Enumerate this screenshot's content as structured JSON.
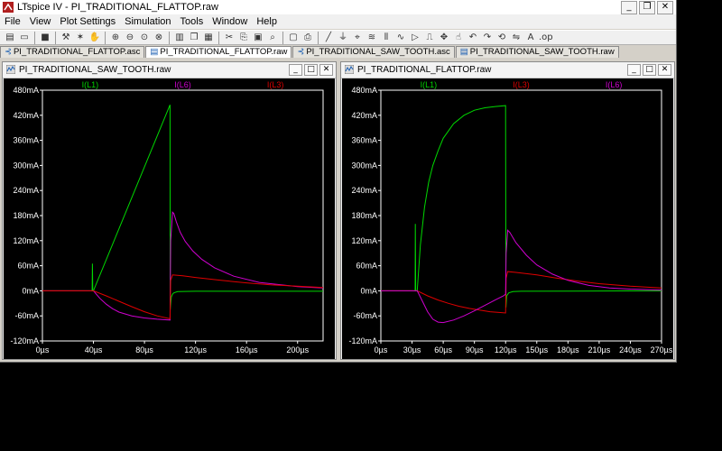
{
  "window": {
    "title": "LTspice IV - PI_TRADITIONAL_FLATTOP.raw",
    "buttons": {
      "minimize": "_",
      "restore": "❐",
      "close": "✕"
    }
  },
  "menu": [
    "File",
    "View",
    "Plot Settings",
    "Simulation",
    "Tools",
    "Window",
    "Help"
  ],
  "tabs": [
    {
      "label": "PI_TRADITIONAL_FLATTOP.asc",
      "icon": "schematic-icon",
      "active": false
    },
    {
      "label": "PI_TRADITIONAL_FLATTOP.raw",
      "icon": "waveform-icon",
      "active": true
    },
    {
      "label": "PI_TRADITIONAL_SAW_TOOTH.asc",
      "icon": "schematic-icon",
      "active": false
    },
    {
      "label": "PI_TRADITIONAL_SAW_TOOTH.raw",
      "icon": "waveform-icon",
      "active": false
    }
  ],
  "colors": {
    "green": "#00d800",
    "magenta": "#d000d0",
    "red": "#e00000",
    "plot_bg": "#000000",
    "axis": "#ffffff"
  },
  "panes": {
    "left": {
      "title": "PI_TRADITIONAL_SAW_TOOTH.raw",
      "btn_min": "_",
      "btn_max": "□",
      "btn_close": "✕"
    },
    "right": {
      "title": "PI_TRADITIONAL_FLATTOP.raw",
      "btn_min": "_",
      "btn_max": "□",
      "btn_close": "✕"
    }
  },
  "chart_data": [
    {
      "type": "line",
      "title": "",
      "xlabel": "",
      "ylabel": "",
      "xlim": [
        0,
        220
      ],
      "ylim": [
        -120,
        480
      ],
      "x_unit": "µs",
      "y_unit": "mA",
      "x_ticks": [
        0,
        40,
        80,
        120,
        160,
        200
      ],
      "x_tick_labels": [
        "0µs",
        "40µs",
        "80µs",
        "120µs",
        "160µs",
        "200µs"
      ],
      "y_ticks": [
        480,
        420,
        360,
        300,
        240,
        180,
        120,
        60,
        0,
        -60,
        -120
      ],
      "y_tick_labels": [
        "480mA",
        "420mA",
        "360mA",
        "300mA",
        "240mA",
        "180mA",
        "120mA",
        "60mA",
        "0mA",
        "-60mA",
        "-120mA"
      ],
      "legend": [
        "I(L1)",
        "I(L6)",
        "I(L3)"
      ],
      "series": [
        {
          "name": "I(L1)",
          "color": "green",
          "x": [
            0,
            39,
            39.2,
            39.5,
            40,
            100,
            100.2,
            101,
            102,
            103,
            106,
            120,
            220
          ],
          "y": [
            0,
            0,
            65,
            0,
            0,
            445,
            -45,
            -15,
            -8,
            -5,
            -2,
            -1,
            -1
          ]
        },
        {
          "name": "I(L6)",
          "color": "magenta",
          "x": [
            0,
            40,
            45,
            50,
            55,
            60,
            70,
            80,
            90,
            100,
            100.5,
            102,
            103,
            105,
            108,
            112,
            118,
            125,
            135,
            150,
            170,
            200,
            220
          ],
          "y": [
            0,
            0,
            -18,
            -32,
            -43,
            -51,
            -60,
            -65,
            -68,
            -70,
            120,
            188,
            185,
            165,
            140,
            118,
            95,
            75,
            55,
            35,
            20,
            10,
            7
          ]
        },
        {
          "name": "I(L3)",
          "color": "red",
          "x": [
            0,
            40,
            50,
            60,
            70,
            80,
            90,
            100,
            100.5,
            102,
            110,
            120,
            140,
            160,
            180,
            200,
            220
          ],
          "y": [
            0,
            0,
            -12,
            -25,
            -38,
            -50,
            -60,
            -67,
            25,
            38,
            36,
            32,
            25,
            19,
            14,
            11,
            8
          ]
        }
      ]
    },
    {
      "type": "line",
      "title": "",
      "xlabel": "",
      "ylabel": "",
      "xlim": [
        0,
        270
      ],
      "ylim": [
        -120,
        480
      ],
      "x_unit": "µs",
      "y_unit": "mA",
      "x_ticks": [
        0,
        30,
        60,
        90,
        120,
        150,
        180,
        210,
        240,
        270
      ],
      "x_tick_labels": [
        "0µs",
        "30µs",
        "60µs",
        "90µs",
        "120µs",
        "150µs",
        "180µs",
        "210µs",
        "240µs",
        "270µs"
      ],
      "y_ticks": [
        480,
        420,
        360,
        300,
        240,
        180,
        120,
        60,
        0,
        -60,
        -120
      ],
      "y_tick_labels": [
        "480mA",
        "420mA",
        "360mA",
        "300mA",
        "240mA",
        "180mA",
        "120mA",
        "60mA",
        "0mA",
        "-60mA",
        "-120mA"
      ],
      "legend": [
        "I(L1)",
        "I(L3)",
        "I(L6)"
      ],
      "series": [
        {
          "name": "I(L1)",
          "color": "green",
          "x": [
            0,
            33,
            33.2,
            33.5,
            35,
            38,
            42,
            46,
            50,
            55,
            60,
            70,
            80,
            90,
            100,
            110,
            120,
            120.3,
            121,
            123,
            127,
            135,
            270
          ],
          "y": [
            0,
            0,
            160,
            0,
            0,
            110,
            200,
            260,
            300,
            335,
            365,
            400,
            420,
            432,
            438,
            441,
            443,
            -40,
            -12,
            -5,
            -2,
            -1,
            0
          ]
        },
        {
          "name": "I(L3)",
          "color": "red",
          "x": [
            0,
            35,
            45,
            55,
            65,
            75,
            85,
            95,
            105,
            115,
            120,
            120.5,
            122,
            130,
            150,
            170,
            190,
            210,
            240,
            270
          ],
          "y": [
            0,
            0,
            -12,
            -22,
            -30,
            -37,
            -42,
            -46,
            -50,
            -52,
            -53,
            30,
            46,
            44,
            38,
            30,
            23,
            17,
            11,
            7
          ]
        },
        {
          "name": "I(L6)",
          "color": "magenta",
          "x": [
            0,
            35,
            40,
            45,
            50,
            55,
            60,
            70,
            80,
            90,
            100,
            110,
            118,
            120,
            120.5,
            122,
            124,
            130,
            140,
            150,
            165,
            180,
            200,
            220,
            240,
            270
          ],
          "y": [
            0,
            0,
            -25,
            -50,
            -68,
            -75,
            -76,
            -70,
            -60,
            -48,
            -35,
            -22,
            -12,
            -8,
            90,
            145,
            140,
            115,
            85,
            62,
            40,
            25,
            13,
            7,
            4,
            2
          ]
        }
      ]
    }
  ]
}
